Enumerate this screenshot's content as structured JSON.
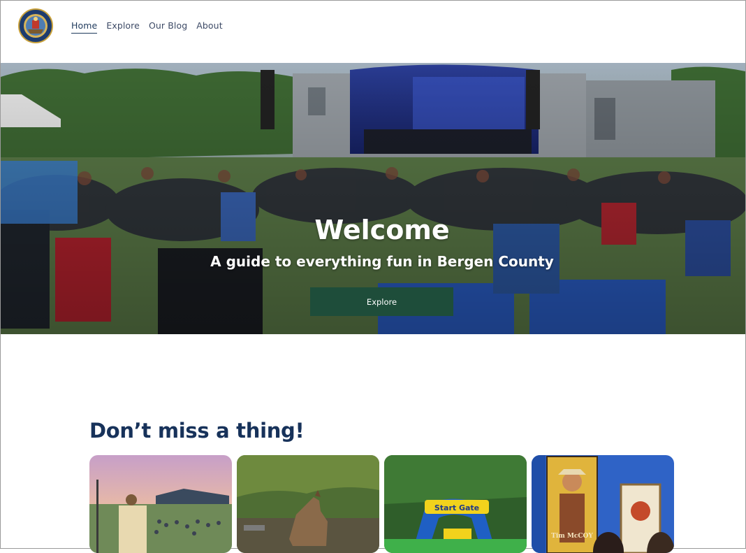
{
  "header": {
    "logo_icon": "county-seal-logo",
    "nav": [
      {
        "label": "Home",
        "active": true
      },
      {
        "label": "Explore",
        "active": false
      },
      {
        "label": "Our Blog",
        "active": false
      },
      {
        "label": "About",
        "active": false
      }
    ]
  },
  "hero": {
    "title": "Welcome",
    "subtitle": "A guide to everything fun in Bergen County",
    "button_label": "Explore"
  },
  "section": {
    "title": "Don’t miss a thing!",
    "cards": [
      {
        "image": "outdoor-concert-photo"
      },
      {
        "image": "coyote-wildlife-photo"
      },
      {
        "image": "inflatable-obstacle-course-photo",
        "sign_text": "Start Gate"
      },
      {
        "image": "museum-posters-photo",
        "poster_text": "Tim McCOY"
      }
    ]
  },
  "colors": {
    "nav_text": "#3d4a66",
    "button_bg": "#1e4d3a",
    "section_title": "#17325a"
  }
}
